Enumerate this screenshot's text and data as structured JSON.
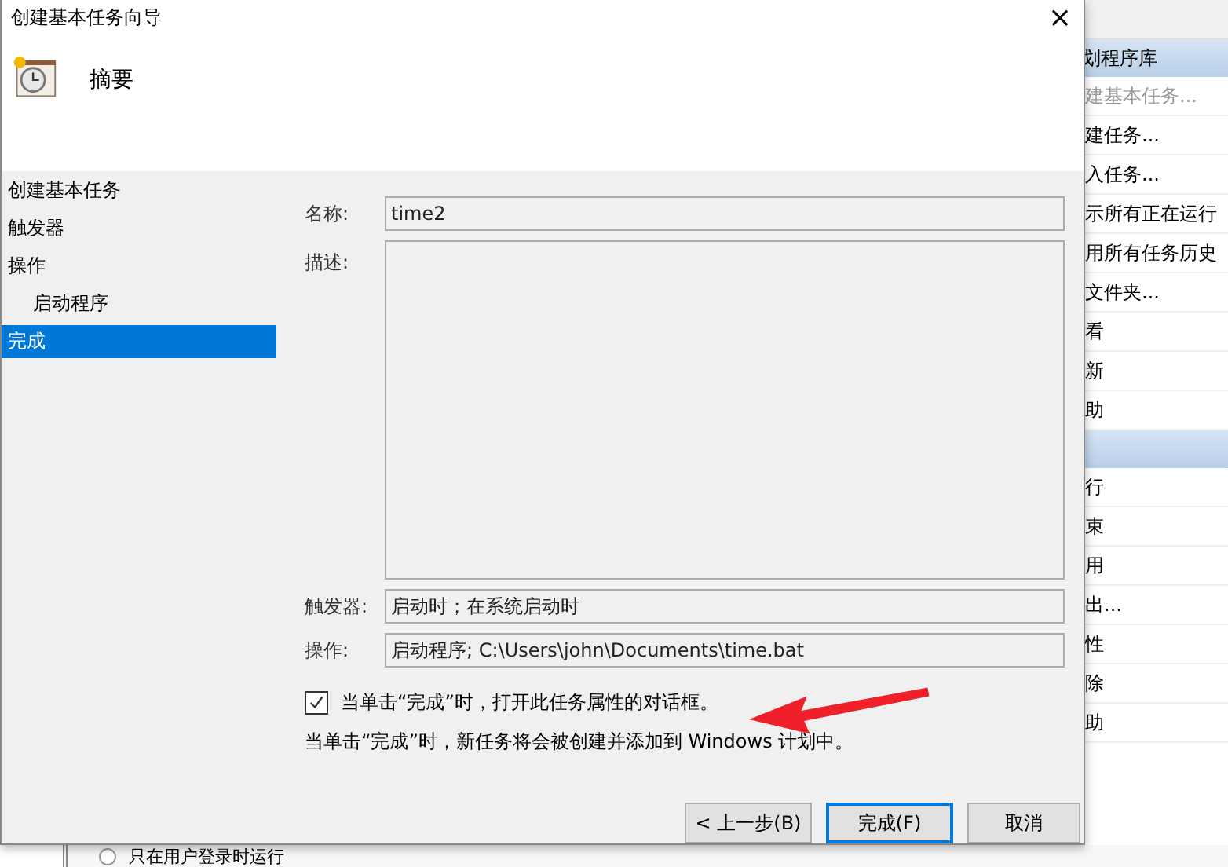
{
  "background_app": {
    "sections": [
      {
        "title": "划程序库",
        "items": [
          {
            "label": "建基本任务...",
            "disabled": true
          },
          {
            "label": "建任务...",
            "disabled": false
          },
          {
            "label": "入任务...",
            "disabled": false
          },
          {
            "label": "示所有正在运行",
            "disabled": false
          },
          {
            "label": "用所有任务历史",
            "disabled": false
          },
          {
            "label": "文件夹...",
            "disabled": false
          },
          {
            "label": "看",
            "disabled": false
          },
          {
            "label": "新",
            "disabled": false
          },
          {
            "label": "助",
            "disabled": false
          }
        ]
      },
      {
        "items": [
          {
            "label": "行",
            "disabled": false
          },
          {
            "label": "束",
            "disabled": false
          },
          {
            "label": "用",
            "disabled": false
          },
          {
            "label": "出...",
            "disabled": false
          },
          {
            "label": "性",
            "disabled": false
          },
          {
            "label": "除",
            "disabled": false
          },
          {
            "label": "助",
            "disabled": false
          }
        ]
      }
    ],
    "bottom_option": {
      "label": "只在用户登录时运行",
      "selected": false
    }
  },
  "dialog": {
    "title": "创建基本任务向导",
    "close": "×",
    "header": "摘要",
    "steps": [
      {
        "label": "创建基本任务",
        "selected": false
      },
      {
        "label": "触发器",
        "selected": false
      },
      {
        "label": "操作",
        "selected": false,
        "children": [
          {
            "label": "启动程序",
            "selected": false
          }
        ]
      },
      {
        "label": "完成",
        "selected": true
      }
    ],
    "fields": [
      {
        "label": "名称:",
        "value": "time2",
        "kind": "single"
      },
      {
        "label": "描述:",
        "kind": "multi"
      },
      {
        "label": "触发器:",
        "value": "启动时；在系统启动时",
        "kind": "single"
      },
      {
        "label": "操作:",
        "value": "启动程序; C:\\Users\\john\\Documents\\time.bat",
        "kind": "single"
      }
    ],
    "open_properties": {
      "label": "当单击“完成”时，打开此任务属性的对话框。",
      "checked": true
    },
    "note": "当单击“完成”时，新任务将会被创建并添加到 Windows 计划中。",
    "buttons": [
      {
        "label": "< 上一步(B)",
        "kind": "normal"
      },
      {
        "label": "完成(F)",
        "kind": "default"
      },
      {
        "label": "取消",
        "kind": "normal"
      }
    ]
  }
}
